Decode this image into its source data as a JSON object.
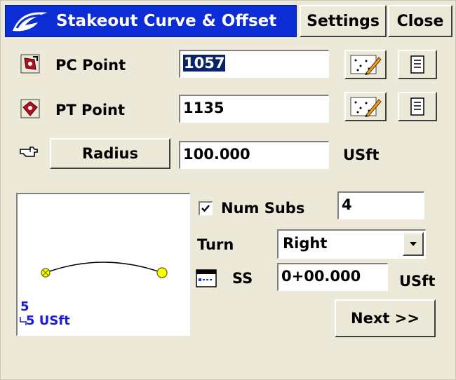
{
  "window": {
    "title": "Stakeout Curve & Offset",
    "settings_label": "Settings",
    "close_label": "Close"
  },
  "pc_point": {
    "label": "PC Point",
    "value": "1057"
  },
  "pt_point": {
    "label": "PT Point",
    "value": "1135"
  },
  "radius": {
    "button_label": "Radius",
    "value": "100.000",
    "unit": "USft"
  },
  "num_subs": {
    "label": "Num Subs",
    "checked": true,
    "value": "4"
  },
  "turn": {
    "label": "Turn",
    "selected": "Right"
  },
  "ss": {
    "label": "SS",
    "value": "0+00.000",
    "unit": "USft"
  },
  "graphic": {
    "scale_line1": "5",
    "scale_line2": "5 USft"
  },
  "next_label": "Next >>",
  "colors": {
    "title_bar": "#0c2cd6",
    "scale_text": "#1a1ad8",
    "point_fill": "#ffff00",
    "selection": "#0a246a"
  },
  "icons": {
    "app_logo": "carlson-logo",
    "pc_point": "pc-point-icon",
    "pt_point": "pt-point-icon",
    "radius": "pointing-hand-icon",
    "pick_map": "map-pick-icon",
    "list": "point-list-icon",
    "ss": "station-icon"
  }
}
